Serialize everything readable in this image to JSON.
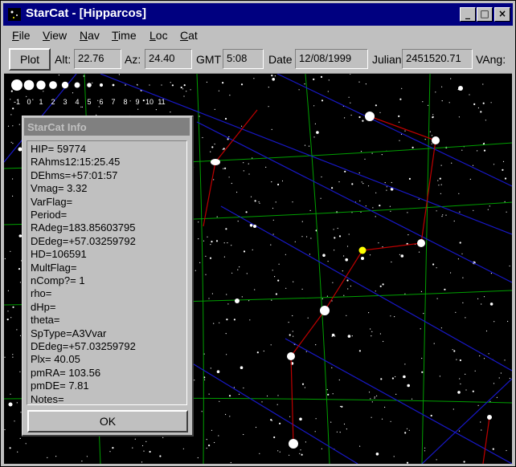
{
  "window": {
    "title": "StarCat - [Hipparcos]",
    "minimize": "_",
    "maximize": "□",
    "close": "×"
  },
  "menu": [
    "File",
    "View",
    "Nav",
    "Time",
    "Loc",
    "Cat"
  ],
  "toolbar": {
    "plot_label": "Plot",
    "alt_label": "Alt:",
    "alt_value": "22.76",
    "az_label": "Az:",
    "az_value": "24.40",
    "gmt_label": "GMT",
    "gmt_value": "5:08",
    "date_label": "Date",
    "date_value": "12/08/1999",
    "julian_label": "Julian",
    "julian_value": "2451520.71",
    "vang_label": "VAng:"
  },
  "magnitude_scale": [
    "-1",
    "0",
    "1",
    "2",
    "3",
    "4",
    "5",
    "6",
    "7",
    "8",
    "9",
    "10",
    "11"
  ],
  "info": {
    "title": "StarCat Info",
    "lines": [
      "HIP= 59774",
      "RAhms12:15:25.45",
      "DEhms=+57:01:57",
      "Vmag= 3.32",
      "VarFlag=",
      "Period=",
      "RAdeg=183.85603795",
      "DEdeg=+57.03259792",
      "HD=106591",
      "MultFlag=",
      "nComp?= 1",
      "rho=",
      "dHp=",
      "theta=",
      "SpType=A3Vvar",
      "DEdeg=+57.03259792",
      "Plx= 40.05",
      "pmRA= 103.56",
      "pmDE=   7.81",
      "Notes="
    ],
    "ok_label": "OK"
  },
  "colors": {
    "titlebar": "#000080",
    "sky": "#000000",
    "grid_green": "#00a000",
    "grid_blue": "#1010c0",
    "constellation": "#c00000",
    "selected_star": "#ffff00"
  }
}
